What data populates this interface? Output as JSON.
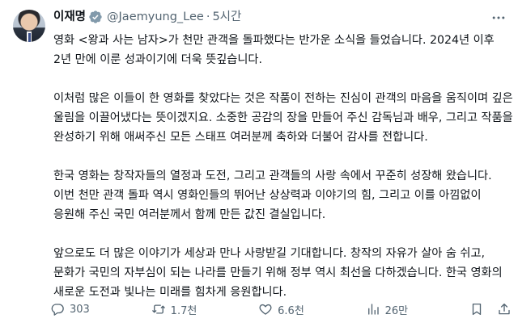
{
  "tweet": {
    "author_name": "이재명",
    "handle": "@Jaemyung_Lee",
    "separator": "·",
    "time": "5시간",
    "paragraphs": [
      "영화 <왕과 사는 남자>가 천만 관객을 돌파했다는 반가운 소식을 들었습니다. 2024년 이후 2년 만에 이룬 성과이기에 더욱 뜻깊습니다.",
      "이처럼 많은 이들이 한 영화를 찾았다는 것은 작품이 전하는 진심이 관객의 마음을 움직이며 깊은 울림을 이끌어냈다는 뜻이겠지요. 소중한 공감의 장을 만들어 주신 감독님과 배우, 그리고 작품을 완성하기 위해 애써주신 모든 스태프 여러분께 축하와 더불어 감사를 전합니다.",
      "한국 영화는 창작자들의 열정과 도전, 그리고 관객들의 사랑 속에서 꾸준히 성장해 왔습니다. 이번 천만 관객 돌파 역시 영화인들의 뛰어난 상상력과 이야기의 힘, 그리고 이를 아낌없이 응원해 주신 국민 여러분께서 함께 만든 값진 결실입니다.",
      "앞으로도 더 많은 이야기가 세상과 만나 사랑받길 기대합니다. 창작의 자유가 살아 숨 쉬고, 문화가 국민의 자부심이 되는 나라를 만들기 위해 정부 역시 최선을 다하겠습니다. 한국 영화의 새로운 도전과 빛나는 미래를 힘차게 응원합니다."
    ]
  },
  "actions": {
    "replies": "303",
    "reposts": "1.7천",
    "likes": "6.6천",
    "views": "26만"
  },
  "icons": {
    "verified": "verified-badge-icon",
    "more": "more-icon",
    "reply": "reply-icon",
    "repost": "repost-icon",
    "like": "heart-icon",
    "views": "views-icon",
    "bookmark": "bookmark-icon",
    "share": "share-icon"
  },
  "colors": {
    "text": "#0f1419",
    "secondary": "#536471",
    "verified": "#829aab"
  }
}
